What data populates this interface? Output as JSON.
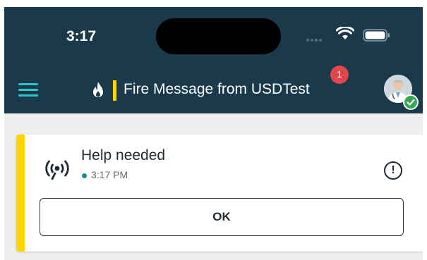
{
  "status_bar": {
    "time": "3:17",
    "wifi_icon": "wifi-icon",
    "battery_icon": "battery-icon"
  },
  "header": {
    "menu_icon": "hamburger-menu-icon",
    "title_icon": "fire-icon",
    "title": "Fire Message from USDTest",
    "notification_count": "1",
    "presence_status": "online",
    "colors": {
      "bar_background": "#1a3a4c",
      "accent_yellow": "#ffd500",
      "menu_teal": "#2cc4c8",
      "badge_red": "#e0464a",
      "presence_green": "#34a853"
    }
  },
  "message": {
    "icon": "broadcast-icon",
    "title": "Help needed",
    "time": "3:17 PM",
    "info_icon": "exclamation-icon",
    "ok_label": "OK"
  }
}
